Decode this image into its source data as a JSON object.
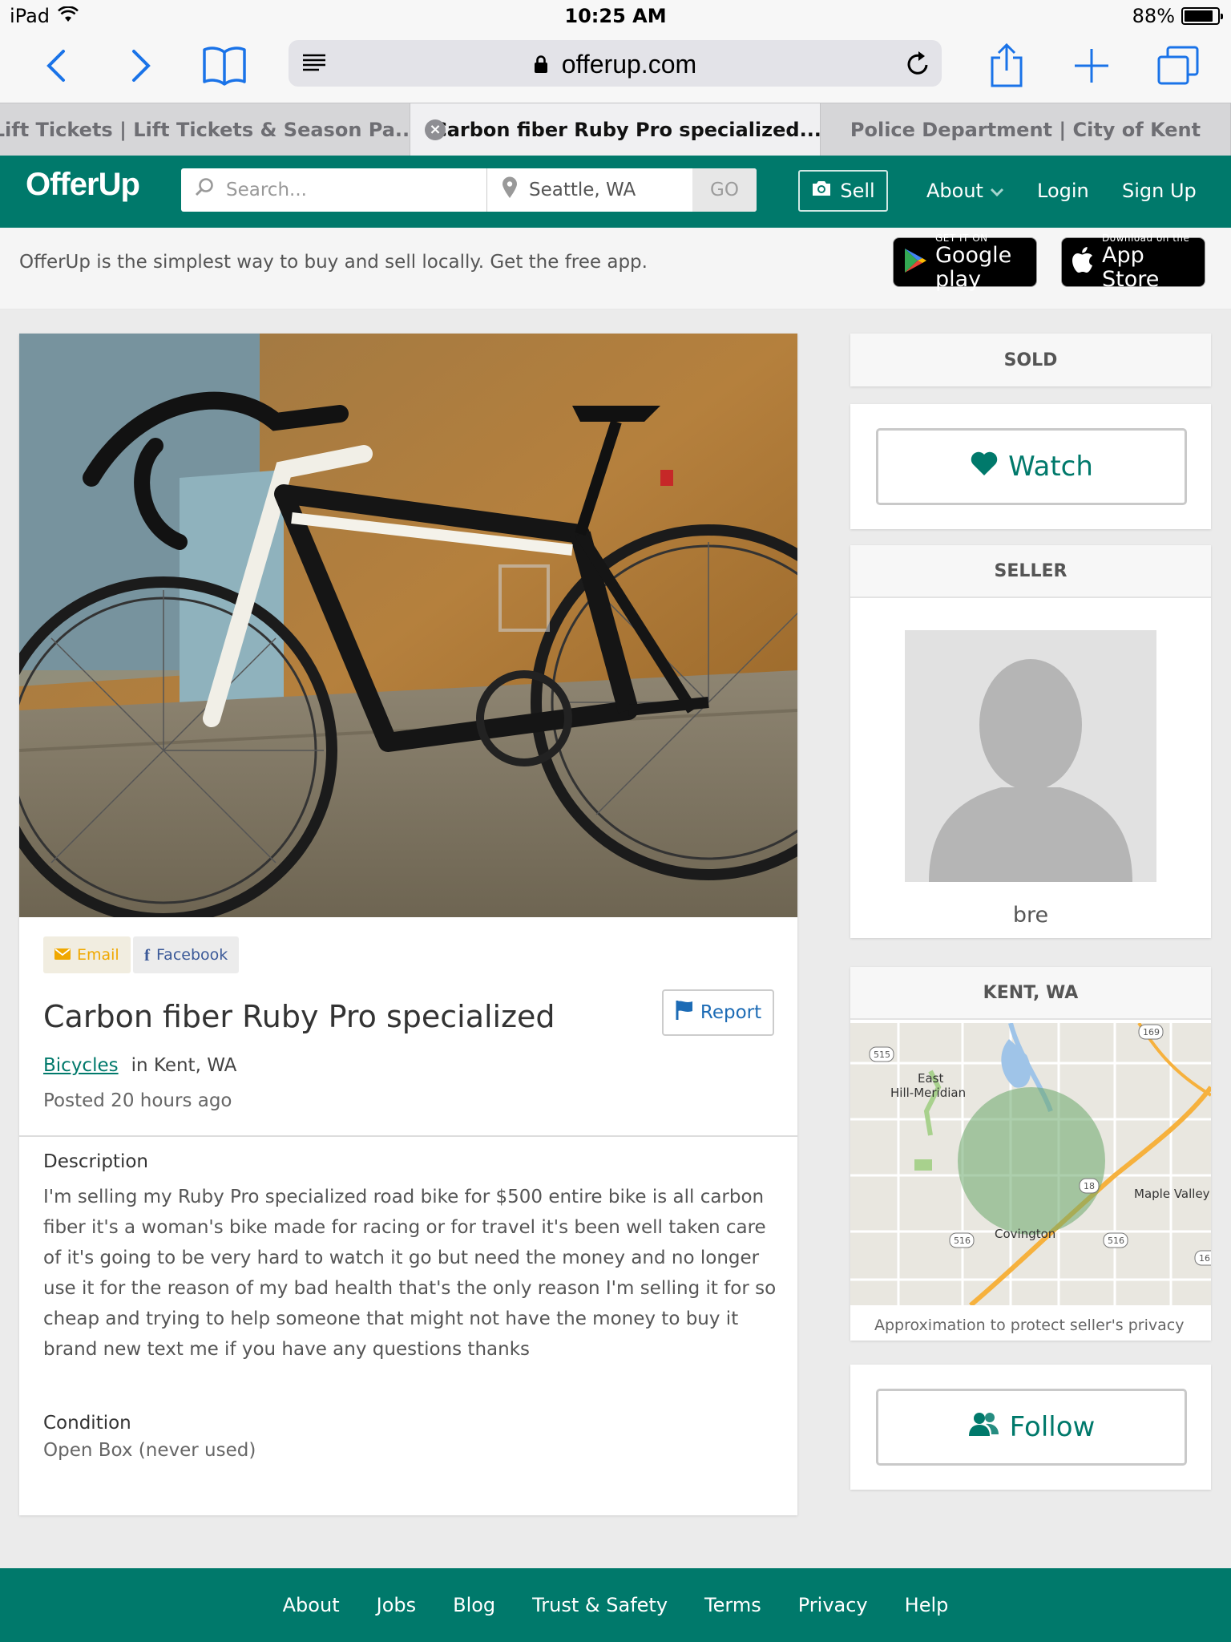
{
  "status_bar": {
    "device": "iPad",
    "time": "10:25 AM",
    "battery": "88%",
    "battery_level": 0.88
  },
  "browser": {
    "url": "offerup.com",
    "tabs": [
      {
        "label": "Lift Tickets | Lift Tickets & Season Pa..."
      },
      {
        "label": "Carbon fiber Ruby Pro specialized..."
      },
      {
        "label": "Police Department | City of Kent"
      }
    ]
  },
  "header": {
    "logo": "OfferUp",
    "search_placeholder": "Search...",
    "location": "Seattle, WA",
    "go_label": "GO",
    "sell_label": "Sell",
    "about_label": "About",
    "login_label": "Login",
    "signup_label": "Sign Up"
  },
  "banner": {
    "text": "OfferUp is the simplest way to buy and sell locally. Get the free app.",
    "google_small": "GET IT ON",
    "google_big": "Google play",
    "apple_small": "Download on the",
    "apple_big": "App Store"
  },
  "listing": {
    "email_label": "Email",
    "facebook_label": "Facebook",
    "title": "Carbon fiber Ruby Pro specialized",
    "report_label": "Report",
    "category": "Bicycles",
    "location": "in Kent, WA",
    "posted": "Posted 20 hours ago",
    "description_label": "Description",
    "description": "I'm selling my Ruby Pro specialized road bike for $500 entire bike is all carbon fiber it's a woman's bike made for racing or for travel it's been well taken care of it's going to be very hard to watch it go but need the money and no longer use it for the reason of my bad health that's the only reason I'm selling it for so cheap and trying to help someone that might not have the money to buy it brand new text me if you have any questions thanks",
    "condition_label": "Condition",
    "condition_value": "Open Box (never used)"
  },
  "sidebar": {
    "sold_label": "SOLD",
    "watch_label": "Watch",
    "seller_heading": "SELLER",
    "seller_name": "bre",
    "location_heading": "KENT, WA",
    "map_labels": {
      "east_hill_1": "East",
      "east_hill_2": "Hill-Meridian",
      "covington": "Covington",
      "maple_valley": "Maple Valley",
      "r515": "515",
      "r169": "169",
      "r18": "18",
      "r516a": "516",
      "r516b": "516",
      "r16": "16"
    },
    "map_note": "Approximation to protect seller's privacy",
    "follow_label": "Follow"
  },
  "footer": {
    "links": [
      "About",
      "Jobs",
      "Blog",
      "Trust & Safety",
      "Terms",
      "Privacy",
      "Help"
    ]
  },
  "colors": {
    "brand": "#00796b",
    "link": "#1c6bb5",
    "email": "#f0a800",
    "facebook": "#3b5998"
  }
}
